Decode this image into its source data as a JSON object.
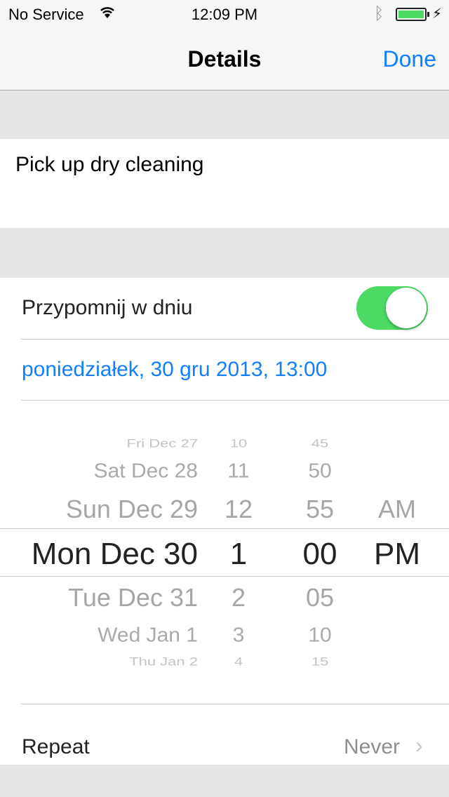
{
  "status_bar": {
    "carrier": "No Service",
    "time": "12:09 PM",
    "battery_color": "#4cd964",
    "icons": [
      "wifi-icon",
      "bluetooth-icon",
      "battery-icon",
      "charging-icon"
    ]
  },
  "nav": {
    "title": "Details",
    "done_label": "Done"
  },
  "note": {
    "text": "Pick up dry cleaning"
  },
  "reminder": {
    "label": "Przypomnij w dniu",
    "enabled": true,
    "date_text": "poniedziałek, 30 gru 2013, 13:00"
  },
  "picker": {
    "rows": [
      {
        "date": "Fri Dec 27",
        "hour": "10",
        "minute": "45",
        "ampm": ""
      },
      {
        "date": "Sat Dec 28",
        "hour": "11",
        "minute": "50",
        "ampm": ""
      },
      {
        "date": "Sun Dec 29",
        "hour": "12",
        "minute": "55",
        "ampm": "AM"
      },
      {
        "date": "Mon Dec 30",
        "hour": "1",
        "minute": "00",
        "ampm": "PM"
      },
      {
        "date": "Tue Dec 31",
        "hour": "2",
        "minute": "05",
        "ampm": ""
      },
      {
        "date": "Wed Jan 1",
        "hour": "3",
        "minute": "10",
        "ampm": ""
      },
      {
        "date": "Thu Jan 2",
        "hour": "4",
        "minute": "15",
        "ampm": ""
      }
    ]
  },
  "repeat": {
    "label": "Repeat",
    "value": "Never"
  },
  "accent": "#147efb"
}
